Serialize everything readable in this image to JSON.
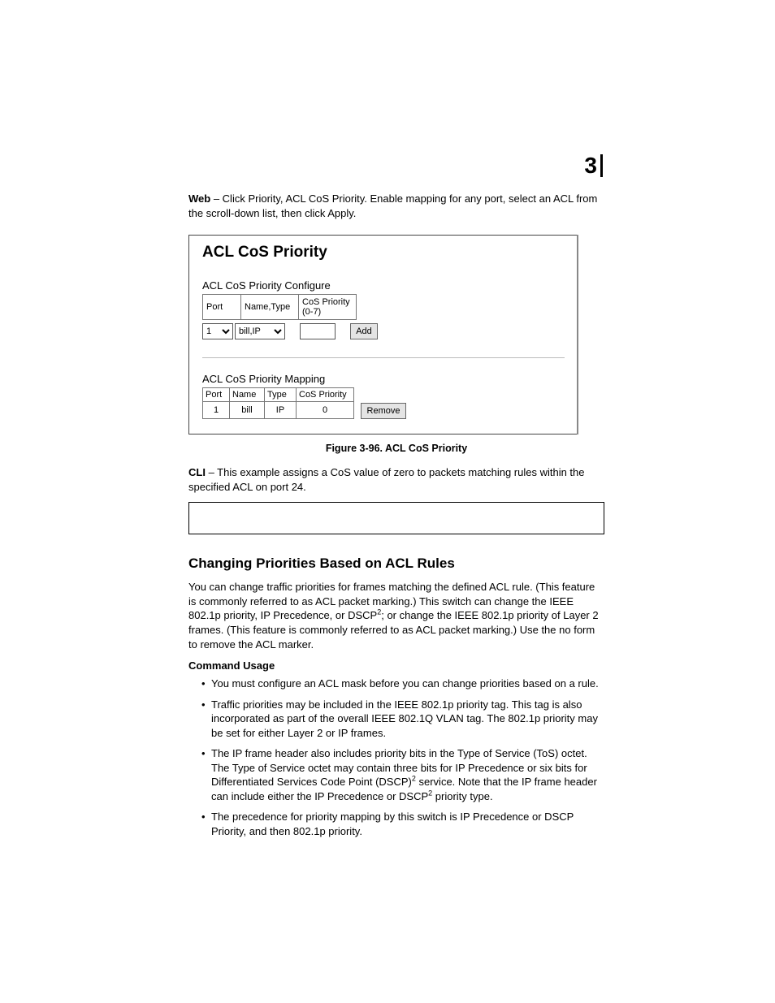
{
  "chapter_number": "3",
  "intro": {
    "web_label": "Web",
    "web_text": " – Click Priority, ACL CoS Priority. Enable mapping for any port, select an ACL from the scroll-down list, then click Apply."
  },
  "figure": {
    "title": "ACL CoS Priority",
    "configure_heading": "ACL CoS Priority Configure",
    "headers": {
      "port": "Port",
      "nametype": "Name,Type",
      "cos": "CoS Priority (0-7)"
    },
    "port_value": "1",
    "nametype_value": "bill,IP",
    "cos_value": "",
    "add_label": "Add",
    "mapping_heading": "ACL CoS Priority Mapping",
    "map_headers": {
      "port": "Port",
      "name": "Name",
      "type": "Type",
      "cos": "CoS Priority"
    },
    "rows": [
      {
        "port": "1",
        "name": "bill",
        "type": "IP",
        "cos": "0"
      }
    ],
    "remove_label": "Remove",
    "caption": "Figure 3-96.  ACL CoS Priority"
  },
  "cli": {
    "label": "CLI",
    "text": " – This example assigns a CoS value of zero to packets matching rules within the specified ACL on port 24."
  },
  "section": {
    "heading": "Changing Priorities Based on ACL Rules",
    "para_before_sup": "You can change traffic priorities for frames matching the defined ACL rule. (This feature is commonly referred to as ACL packet marking.) This switch can change the IEEE 802.1p priority, IP Precedence, or DSCP",
    "sup1": "2",
    "para_after_sup": "; or change the IEEE 802.1p priority of Layer 2 frames. (This feature is commonly referred to as ACL packet marking.) Use the no form to remove the ACL marker.",
    "usage_heading": "Command Usage",
    "bullets": {
      "b1": "You must configure an ACL mask before you can change priorities based on a rule.",
      "b2": "Traffic priorities may be included in the IEEE 802.1p priority tag. This tag is also incorporated as part of the overall IEEE 802.1Q VLAN tag. The 802.1p priority may be set for either Layer 2 or IP frames.",
      "b3_a": "The IP frame header also includes priority bits in the Type of Service (ToS) octet. The Type of Service octet may contain three bits for IP Precedence or six bits for Differentiated Services Code Point (DSCP)",
      "b3_sup1": "2",
      "b3_b": " service. Note that the IP frame header can include either the IP Precedence or DSCP",
      "b3_sup2": "2",
      "b3_c": " priority type.",
      "b4": "The precedence for priority mapping by this switch is IP Precedence or DSCP Priority, and then 802.1p priority."
    }
  }
}
